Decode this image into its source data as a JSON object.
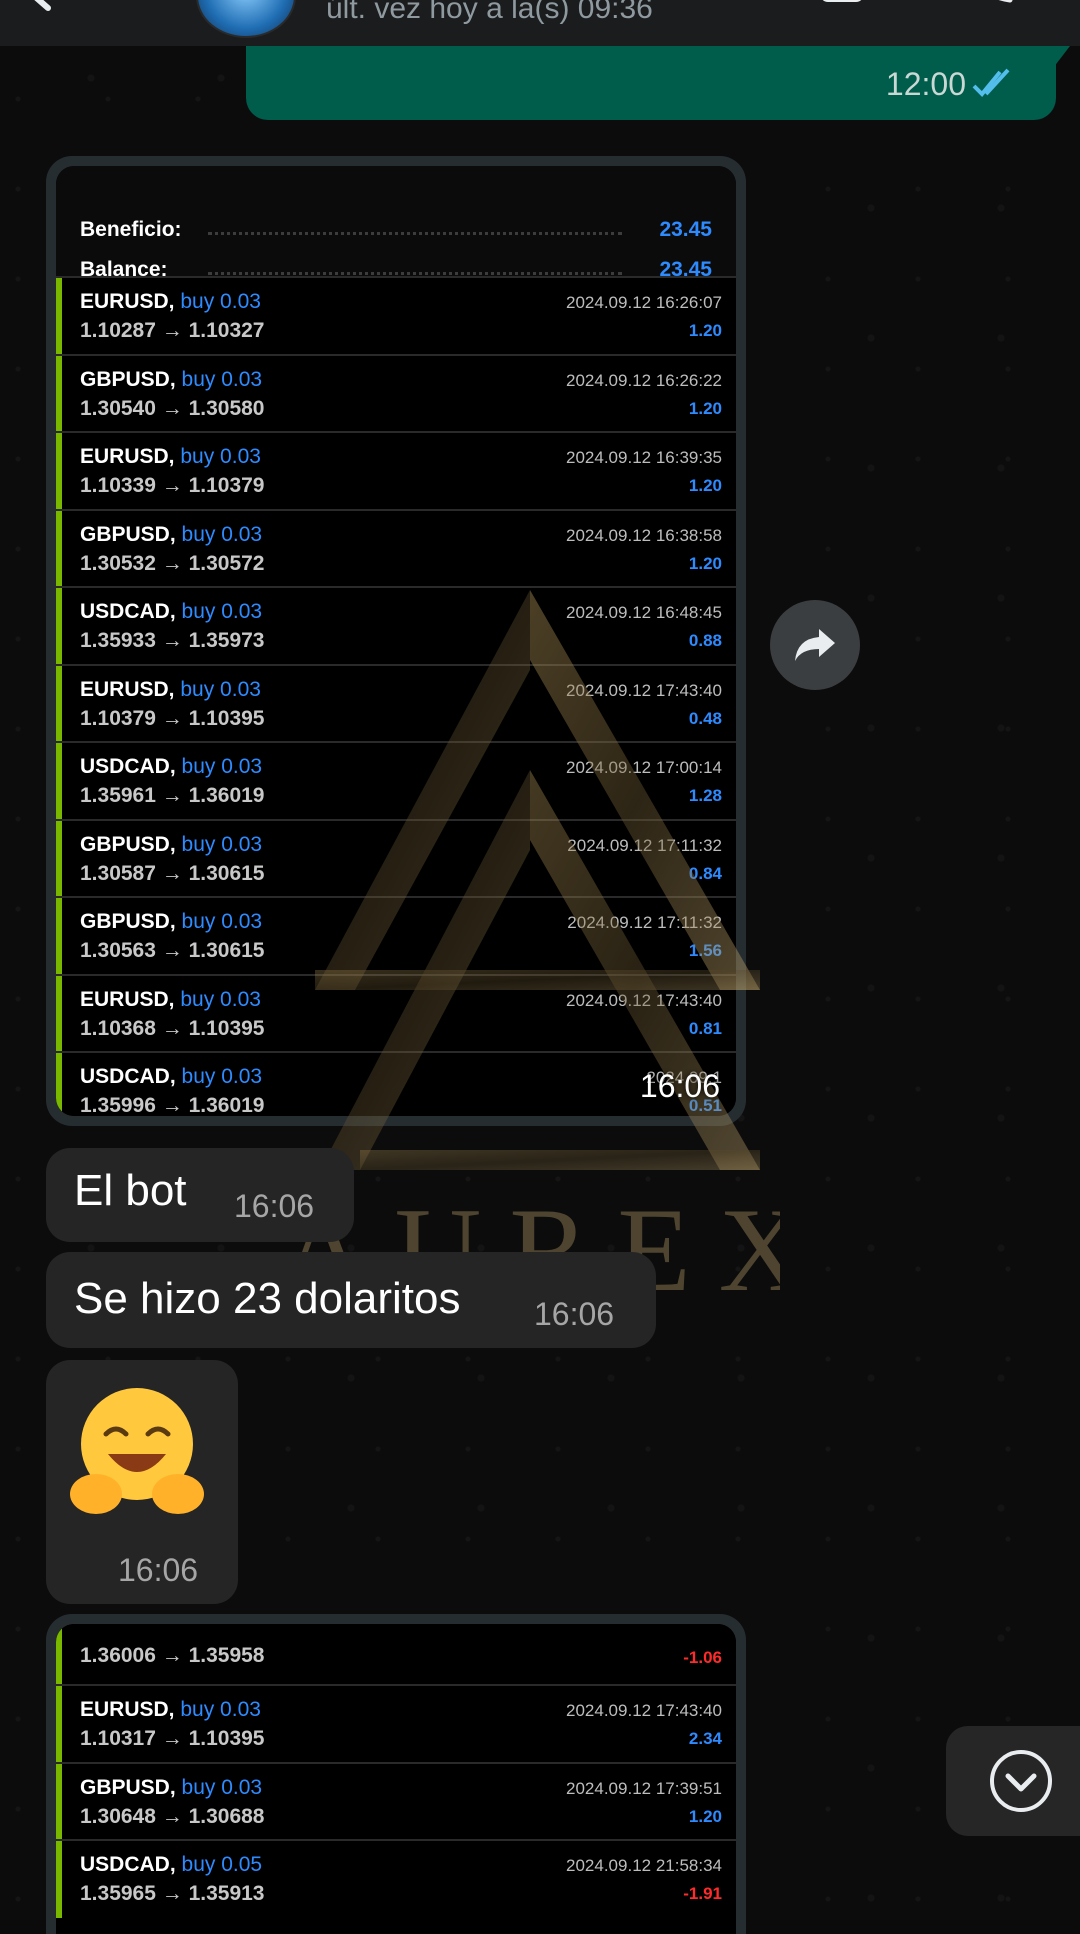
{
  "header": {
    "last_seen": "últ. vez hoy a la(s) 09:36"
  },
  "outgoing": {
    "time": "12:00"
  },
  "screenshot1": {
    "summary": {
      "benefit_label": "Beneficio:",
      "benefit_value": "23.45",
      "balance_label": "Balance:",
      "balance_value": "23.45"
    },
    "trades": [
      {
        "pair": "EURUSD,",
        "side": "buy 0.03",
        "prices": "1.10287 → 1.10327",
        "date": "2024.09.12 16:26:07",
        "profit": "1.20"
      },
      {
        "pair": "GBPUSD,",
        "side": "buy 0.03",
        "prices": "1.30540 → 1.30580",
        "date": "2024.09.12 16:26:22",
        "profit": "1.20"
      },
      {
        "pair": "EURUSD,",
        "side": "buy 0.03",
        "prices": "1.10339 → 1.10379",
        "date": "2024.09.12 16:39:35",
        "profit": "1.20"
      },
      {
        "pair": "GBPUSD,",
        "side": "buy 0.03",
        "prices": "1.30532 → 1.30572",
        "date": "2024.09.12 16:38:58",
        "profit": "1.20"
      },
      {
        "pair": "USDCAD,",
        "side": "buy 0.03",
        "prices": "1.35933 → 1.35973",
        "date": "2024.09.12 16:48:45",
        "profit": "0.88"
      },
      {
        "pair": "EURUSD,",
        "side": "buy 0.03",
        "prices": "1.10379 → 1.10395",
        "date": "2024.09.12 17:43:40",
        "profit": "0.48"
      },
      {
        "pair": "USDCAD,",
        "side": "buy 0.03",
        "prices": "1.35961 → 1.36019",
        "date": "2024.09.12 17:00:14",
        "profit": "1.28"
      },
      {
        "pair": "GBPUSD,",
        "side": "buy 0.03",
        "prices": "1.30587 → 1.30615",
        "date": "2024.09.12 17:11:32",
        "profit": "0.84"
      },
      {
        "pair": "GBPUSD,",
        "side": "buy 0.03",
        "prices": "1.30563 → 1.30615",
        "date": "2024.09.12 17:11:32",
        "profit": "1.56"
      },
      {
        "pair": "EURUSD,",
        "side": "buy 0.03",
        "prices": "1.10368 → 1.10395",
        "date": "2024.09.12 17:43:40",
        "profit": "0.81"
      },
      {
        "pair": "USDCAD,",
        "side": "buy 0.03",
        "prices": "1.35996 → 1.36019",
        "date": "2024.09.1",
        "profit": "0.51"
      }
    ],
    "time": "16:06"
  },
  "messages": [
    {
      "text": "El bot",
      "time": "16:06"
    },
    {
      "text": "Se hizo 23 dolaritos",
      "time": "16:06"
    }
  ],
  "emoji_message": {
    "emoji": "hugging-face",
    "time": "16:06"
  },
  "screenshot2": {
    "first_row": {
      "prices": "1.36006 → 1.35958",
      "profit": "-1.06"
    },
    "trades": [
      {
        "pair": "EURUSD,",
        "side": "buy 0.03",
        "prices": "1.10317 → 1.10395",
        "date": "2024.09.12 17:43:40",
        "profit": "2.34"
      },
      {
        "pair": "GBPUSD,",
        "side": "buy 0.03",
        "prices": "1.30648 → 1.30688",
        "date": "2024.09.12 17:39:51",
        "profit": "1.20"
      },
      {
        "pair": "USDCAD,",
        "side": "buy 0.05",
        "prices": "1.35965 → 1.35913",
        "date": "2024.09.12 21:58:34",
        "profit": "-1.91"
      }
    ]
  },
  "watermark": {
    "text": "AUREX"
  },
  "colors": {
    "outgoing_bubble": "#005c4b",
    "incoming_bubble": "#252525",
    "buy_blue": "#2e8bff",
    "loss_red": "#ff2b2b",
    "trade_bar": "#7ab800"
  }
}
